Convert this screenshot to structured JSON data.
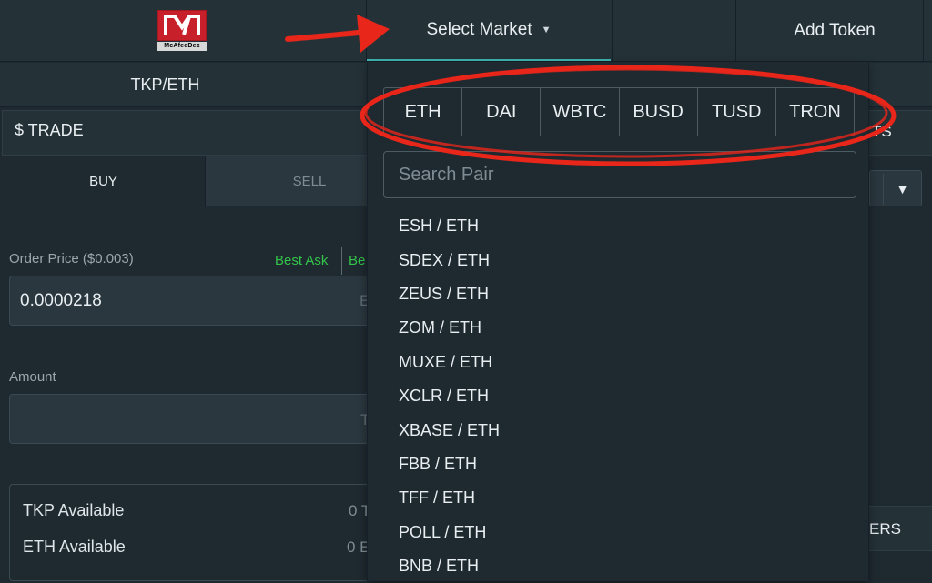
{
  "header": {
    "logo_text": "McAfeeDex",
    "select_market_label": "Select Market",
    "add_token_label": "Add Token"
  },
  "pair": {
    "title": "TKP/ETH"
  },
  "trade": {
    "title": "$ TRADE",
    "buy_label": "BUY",
    "sell_label": "SELL",
    "order_price_label": "Order Price ($0.003)",
    "best_ask_label": "Best Ask",
    "best_bid_label": "Be",
    "order_price_value": "0.0000218",
    "order_price_unit": "E",
    "amount_label": "Amount",
    "amount_unit": "T",
    "tkp_available_label": "TKP Available",
    "tkp_available_value": "0 T",
    "eth_available_label": "ETH Available",
    "eth_available_value": "0 E"
  },
  "right_panel": {
    "header_text": "TS",
    "header2_text": "ERS"
  },
  "dropdown": {
    "tokens": [
      "ETH",
      "DAI",
      "WBTC",
      "BUSD",
      "TUSD",
      "TRON"
    ],
    "search_placeholder": "Search Pair",
    "pairs": [
      "ESH / ETH",
      "SDEX / ETH",
      "ZEUS / ETH",
      "ZOM / ETH",
      "MUXE / ETH",
      "XCLR / ETH",
      "XBASE / ETH",
      "FBB / ETH",
      "TFF / ETH",
      "POLL / ETH",
      "BNB / ETH"
    ]
  },
  "colors": {
    "background": "#1f2a30",
    "accent": "#3fb6b0",
    "best_price_green": "#33c44a",
    "annotation_red": "#e8261a"
  }
}
